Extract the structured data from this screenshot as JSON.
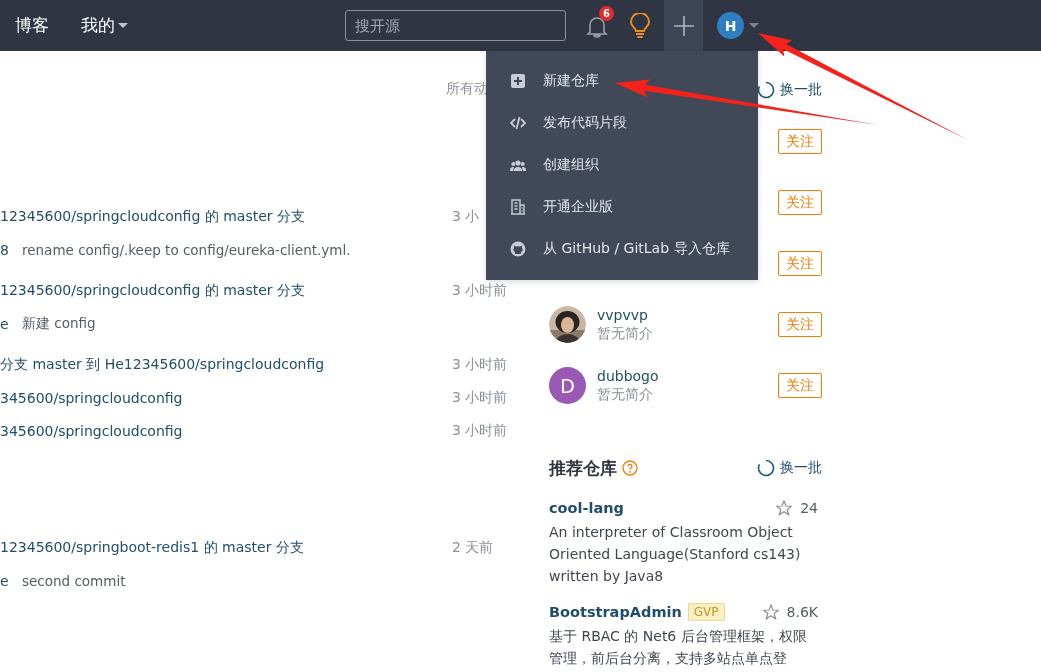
{
  "nav": {
    "links": [
      {
        "label": "博客",
        "dropdown": false
      },
      {
        "label": "我的",
        "dropdown": true
      }
    ],
    "search": {
      "placeholder": "搜开源"
    },
    "notifications": {
      "badge": "6"
    },
    "create_menu_open": true,
    "avatar": {
      "initial": "H"
    }
  },
  "create_menu": {
    "items": [
      {
        "kind": "new",
        "label": "新建仓库"
      },
      {
        "kind": "code",
        "label": "发布代码片段"
      },
      {
        "kind": "org",
        "label": "创建组织"
      },
      {
        "kind": "enterprise",
        "label": "开通企业版"
      },
      {
        "kind": "import",
        "label": "从 GitHub / GitLab 导入仓库"
      }
    ]
  },
  "feed": {
    "filter": "所有动",
    "events": [
      {
        "title": "12345600/springcloudconfig 的 master 分支",
        "time": "3 小",
        "commit": {
          "sha": "8",
          "message": "rename config/.keep to config/eureka-client.yml."
        }
      },
      {
        "title": "12345600/springcloudconfig 的 master 分支",
        "time": "3 小时前",
        "commit": {
          "sha": "e",
          "message": "新建 config"
        }
      },
      {
        "title": "分支 master 到 He12345600/springcloudconfig",
        "time": "3 小时前"
      },
      {
        "title": "345600/springcloudconfig",
        "time": "3 小时前"
      },
      {
        "title": "345600/springcloudconfig",
        "time": "3 小时前"
      },
      {
        "title": "12345600/springboot-redis1 的 master 分支",
        "time": "2 天前",
        "commit": {
          "sha": "e",
          "message": "second commit"
        }
      }
    ]
  },
  "recommended_users": {
    "refresh": "换一批",
    "users": [
      {
        "follow": "关注"
      },
      {
        "follow": "关注"
      },
      {
        "follow": "关注"
      },
      {
        "name": "vvpvvp",
        "bio": "暂无简介",
        "follow": "关注"
      },
      {
        "name": "dubbogo",
        "bio": "暂无简介",
        "kind": "letter",
        "initial": "D",
        "color": "#9b59b6",
        "follow": "关注"
      }
    ]
  },
  "recommended_repos": {
    "title": "推荐仓库",
    "refresh": "换一批",
    "repos": [
      {
        "name": "cool-lang",
        "stars": "24",
        "description": [
          "An interpreter of Classroom Object",
          "Oriented Language(Stanford cs143)",
          "written by Java8"
        ]
      },
      {
        "name": "BootstrapAdmin",
        "badge": "GVP",
        "stars": "8.6K",
        "description": [
          "基于 RBAC 的 Net6 后台管理框架，权限",
          "管理，前后台分离，支持多站点单点登"
        ]
      }
    ]
  },
  "annotations": [
    {
      "kind": "arrow"
    },
    {
      "kind": "arrow"
    }
  ]
}
